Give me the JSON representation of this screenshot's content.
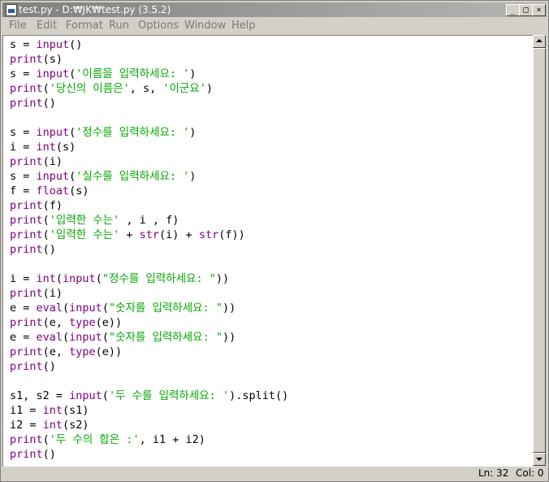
{
  "window": {
    "title": "test.py - D:₩JK₩test.py (3.5.2)",
    "buttons": {
      "minimize": "_",
      "maximize": "□",
      "close": "×"
    }
  },
  "menu": [
    "File",
    "Edit",
    "Format",
    "Run",
    "Options",
    "Window",
    "Help"
  ],
  "code": [
    [
      [
        "s = "
      ],
      [
        "input",
        "kw"
      ],
      [
        "()"
      ]
    ],
    [
      [
        "print",
        "kw"
      ],
      [
        "(s)"
      ]
    ],
    [
      [
        "s = "
      ],
      [
        "input",
        "kw"
      ],
      [
        "("
      ],
      [
        "'이름을 입력하세요: '",
        "str"
      ],
      [
        ")"
      ]
    ],
    [
      [
        "print",
        "kw"
      ],
      [
        "("
      ],
      [
        "'당신의 이름은'",
        "str"
      ],
      [
        ", s, "
      ],
      [
        "'이군요'",
        "str"
      ],
      [
        ")"
      ]
    ],
    [
      [
        "print",
        "kw"
      ],
      [
        "()"
      ]
    ],
    [],
    [
      [
        "s = "
      ],
      [
        "input",
        "kw"
      ],
      [
        "("
      ],
      [
        "'정수를 입력하세요: '",
        "str"
      ],
      [
        ")"
      ]
    ],
    [
      [
        "i = "
      ],
      [
        "int",
        "kw"
      ],
      [
        "(s)"
      ]
    ],
    [
      [
        "print",
        "kw"
      ],
      [
        "(i)"
      ]
    ],
    [
      [
        "s = "
      ],
      [
        "input",
        "kw"
      ],
      [
        "("
      ],
      [
        "'실수를 입력하세요: '",
        "str"
      ],
      [
        ")"
      ]
    ],
    [
      [
        "f = "
      ],
      [
        "float",
        "kw"
      ],
      [
        "(s)"
      ]
    ],
    [
      [
        "print",
        "kw"
      ],
      [
        "(f)"
      ]
    ],
    [
      [
        "print",
        "kw"
      ],
      [
        "("
      ],
      [
        "'입력한 수는'",
        "str"
      ],
      [
        " , i , f)"
      ]
    ],
    [
      [
        "print",
        "kw"
      ],
      [
        "("
      ],
      [
        "'입력한 수는'",
        "str"
      ],
      [
        " + "
      ],
      [
        "str",
        "kw"
      ],
      [
        "(i) + "
      ],
      [
        "str",
        "kw"
      ],
      [
        "(f))"
      ]
    ],
    [
      [
        "print",
        "kw"
      ],
      [
        "()"
      ]
    ],
    [],
    [
      [
        "i = "
      ],
      [
        "int",
        "kw"
      ],
      [
        "("
      ],
      [
        "input",
        "kw"
      ],
      [
        "("
      ],
      [
        "\"정수를 입력하세요: \"",
        "str"
      ],
      [
        "))"
      ]
    ],
    [
      [
        "print",
        "kw"
      ],
      [
        "(i)"
      ]
    ],
    [
      [
        "e = "
      ],
      [
        "eval",
        "kw"
      ],
      [
        "("
      ],
      [
        "input",
        "kw"
      ],
      [
        "("
      ],
      [
        "\"숫자를 입력하세요: \"",
        "str"
      ],
      [
        "))"
      ]
    ],
    [
      [
        "print",
        "kw"
      ],
      [
        "(e, "
      ],
      [
        "type",
        "kw"
      ],
      [
        "(e))"
      ]
    ],
    [
      [
        "e = "
      ],
      [
        "eval",
        "kw"
      ],
      [
        "("
      ],
      [
        "input",
        "kw"
      ],
      [
        "("
      ],
      [
        "\"숫자를 입력하세요: \"",
        "str"
      ],
      [
        "))"
      ]
    ],
    [
      [
        "print",
        "kw"
      ],
      [
        "(e, "
      ],
      [
        "type",
        "kw"
      ],
      [
        "(e))"
      ]
    ],
    [
      [
        "print",
        "kw"
      ],
      [
        "()"
      ]
    ],
    [],
    [
      [
        "s1, s2 = "
      ],
      [
        "input",
        "kw"
      ],
      [
        "("
      ],
      [
        "'두 수를 입력하세요: '",
        "str"
      ],
      [
        ").split()"
      ]
    ],
    [
      [
        "i1 = "
      ],
      [
        "int",
        "kw"
      ],
      [
        "(s1)"
      ]
    ],
    [
      [
        "i2 = "
      ],
      [
        "int",
        "kw"
      ],
      [
        "(s2)"
      ]
    ],
    [
      [
        "print",
        "kw"
      ],
      [
        "("
      ],
      [
        "'두 수의 합은 :'",
        "str"
      ],
      [
        ", i1 + i2)"
      ]
    ],
    [
      [
        "print",
        "kw"
      ],
      [
        "()"
      ]
    ]
  ],
  "status": {
    "line": "Ln: 32",
    "col": "Col: 0"
  },
  "colors": {
    "keyword": "#800080",
    "string": "#00aa00",
    "title_bar": "#808080"
  }
}
